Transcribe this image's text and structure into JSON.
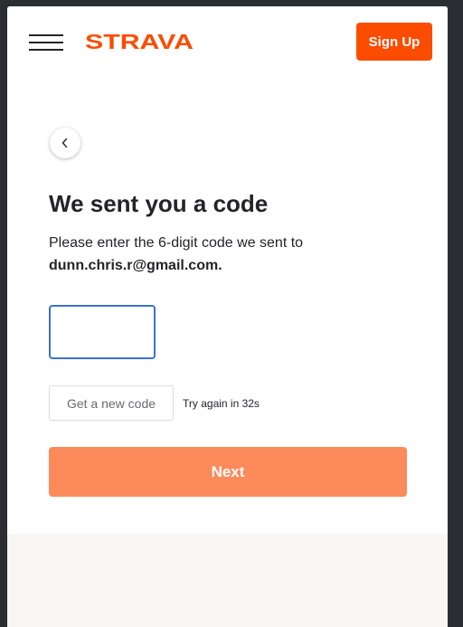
{
  "header": {
    "logo_text": "STRAVA",
    "signup_label": "Sign Up"
  },
  "verify": {
    "title": "We sent you a code",
    "description": "Please enter the 6-digit code we sent to",
    "email": "dunn.chris.r@gmail.com.",
    "code_value": "",
    "new_code_label": "Get a new code",
    "retry_text": "Try again in 32s",
    "next_label": "Next"
  },
  "icons": {
    "menu": "hamburger-menu-icon",
    "back": "chevron-left-icon"
  },
  "colors": {
    "brand": "#fc4c02",
    "next_button": "#fd8a5b",
    "input_focus": "#3a72d1",
    "text": "#242428",
    "page_background": "#f7f6f2"
  }
}
